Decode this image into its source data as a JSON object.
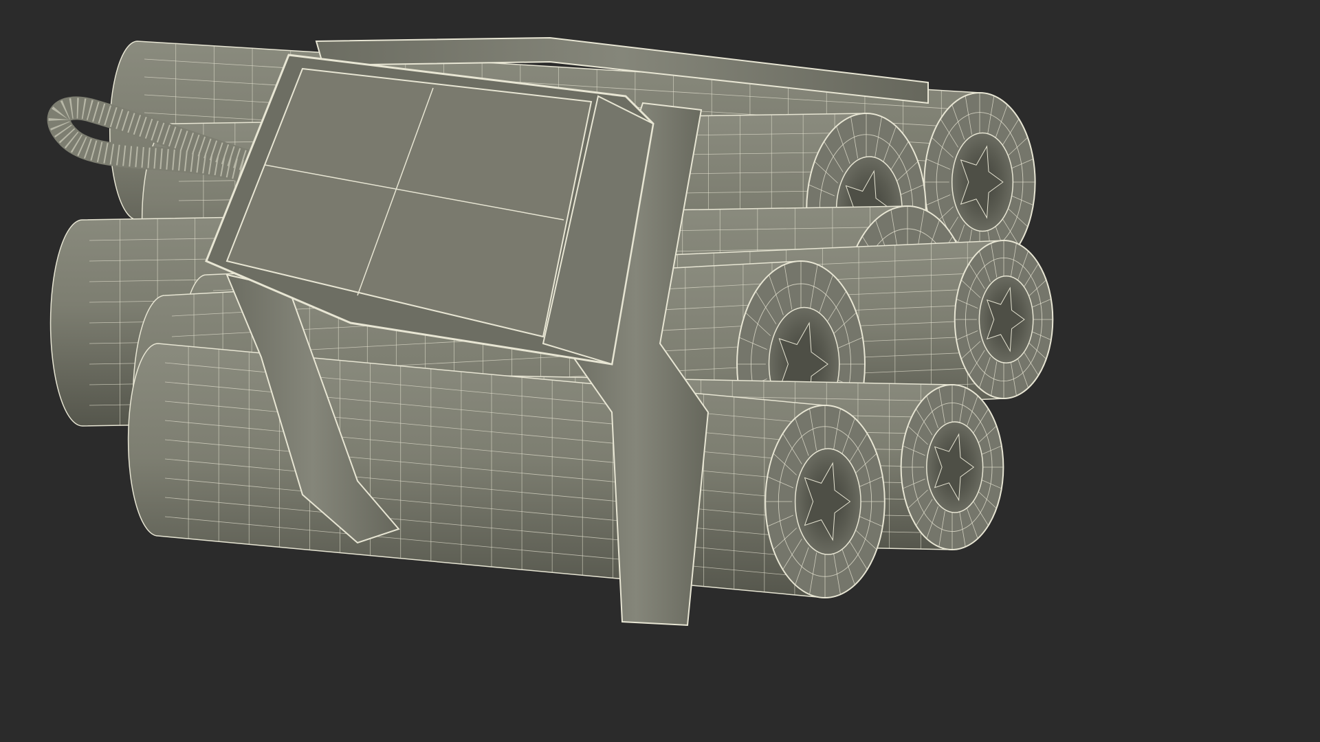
{
  "scene": {
    "subject": "wireframe-dynamite-bundle",
    "stick_count": 9,
    "background_color": "#2b2b2b",
    "surface_color": "#7d7e71",
    "surface_dark": "#5f6055",
    "cap_dark": "#4e4f46",
    "wire_color": "#e8e6d4",
    "display_color": "#7a7a6e"
  }
}
